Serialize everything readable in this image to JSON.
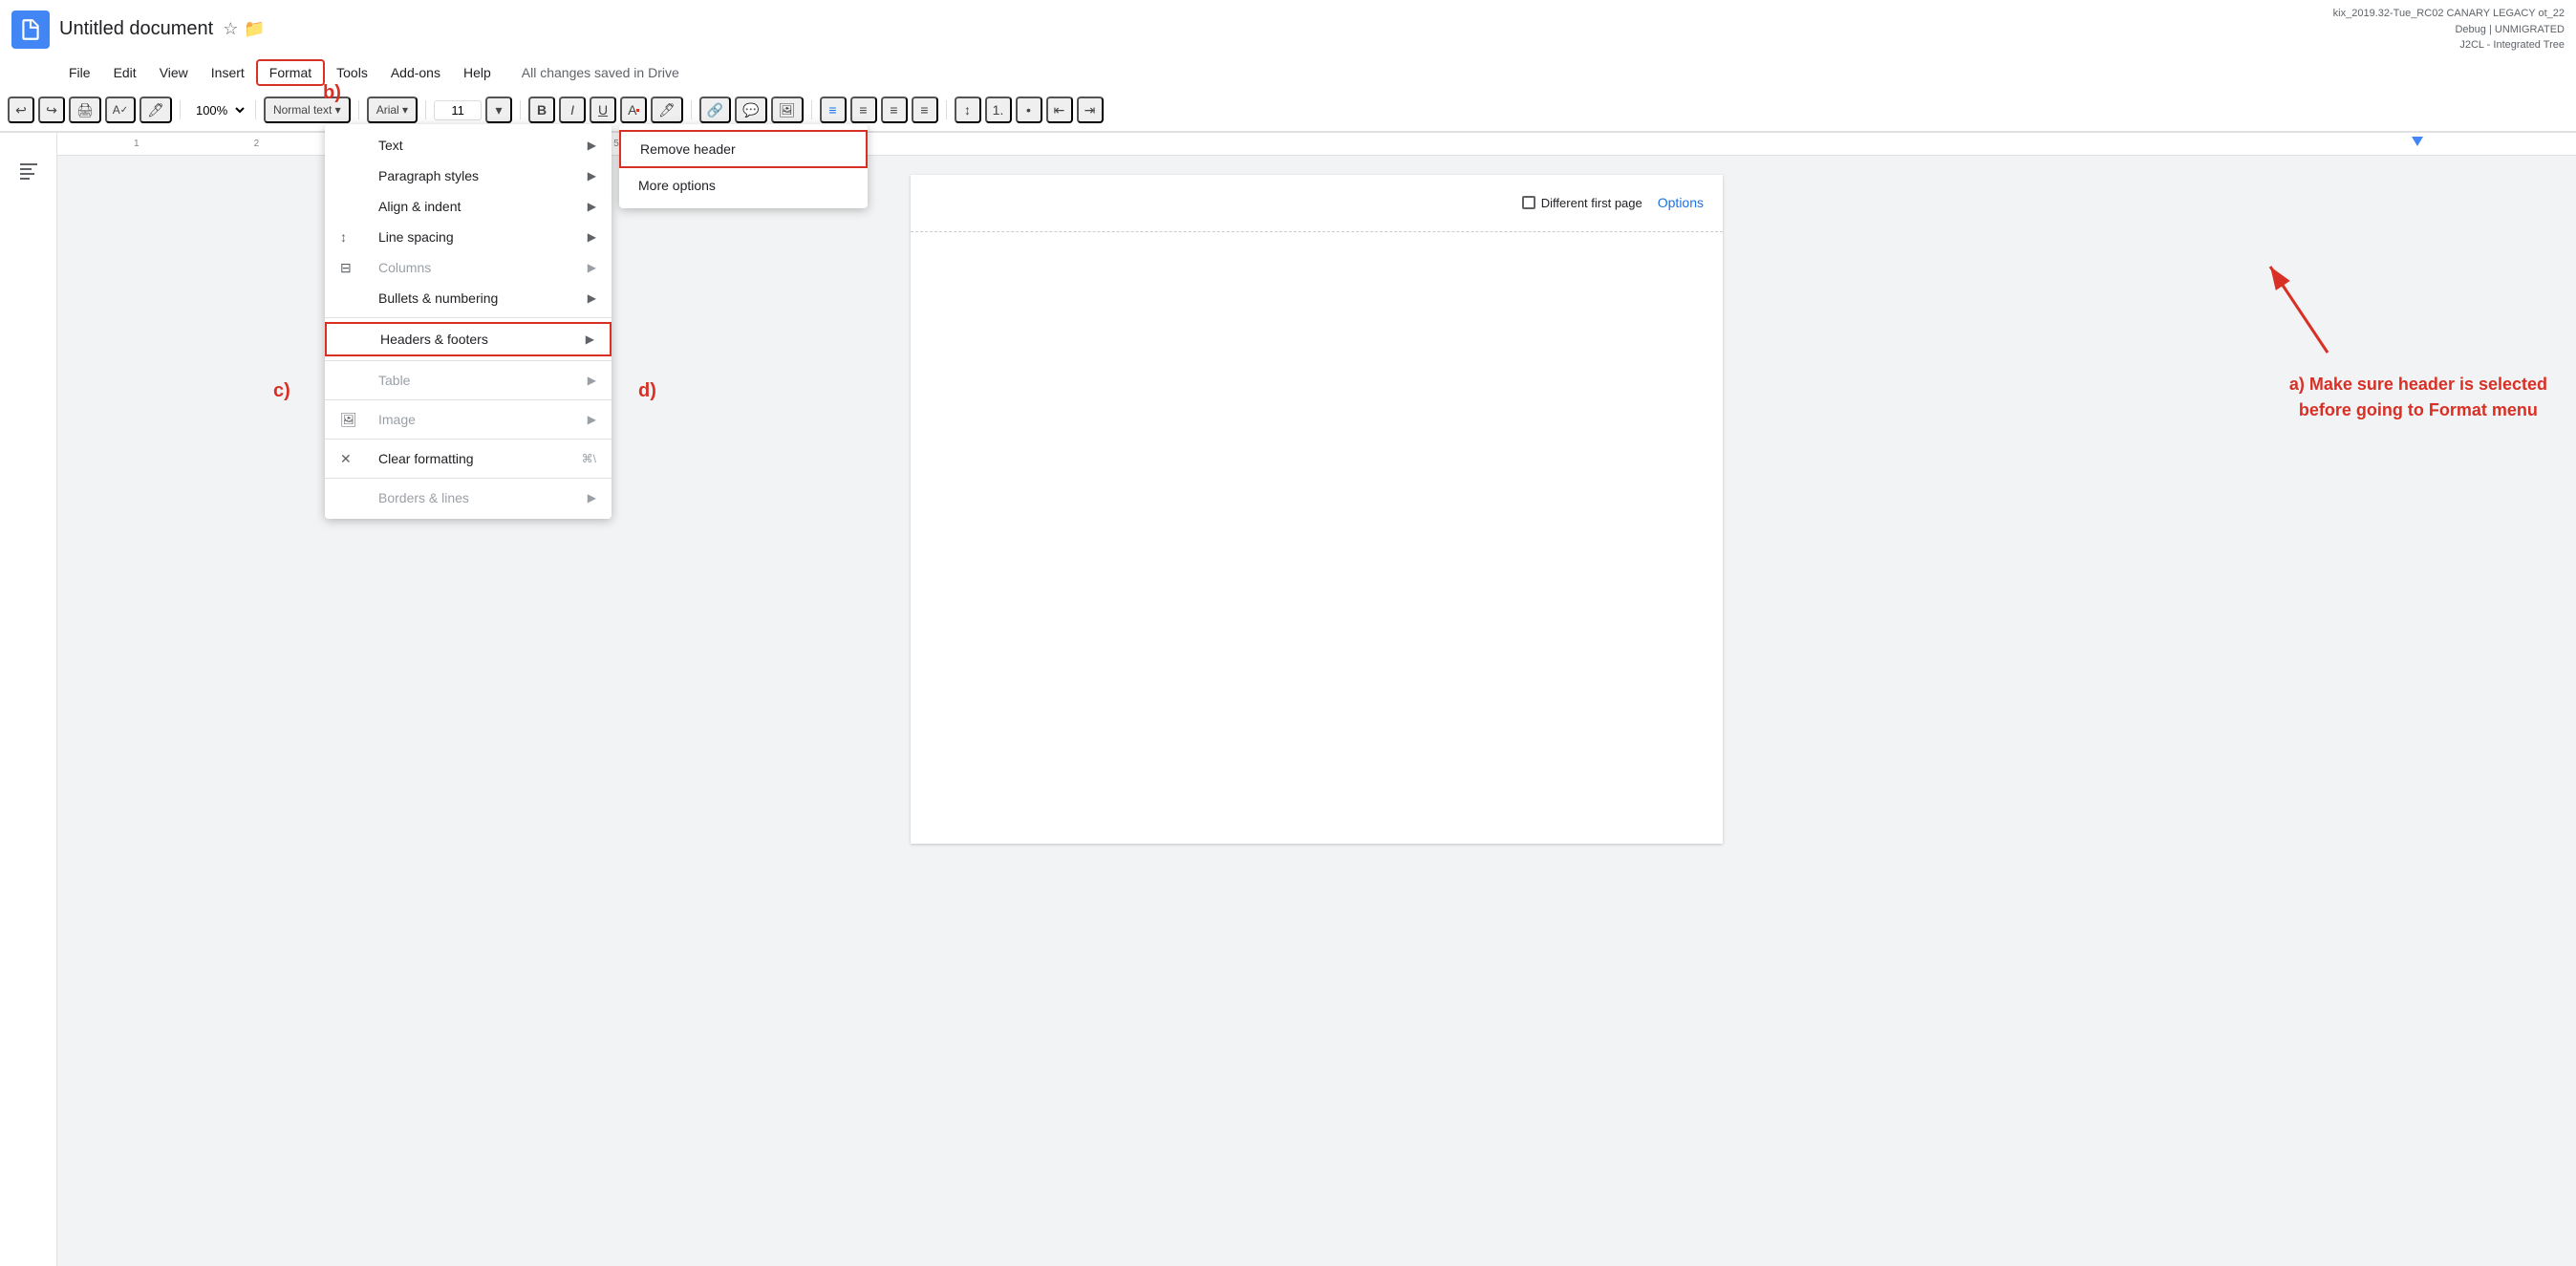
{
  "app": {
    "title": "Untitled document",
    "version_info": "kix_2019.32-Tue_RC02 CANARY LEGACY ot_22\nDebug | UNMIGRATED\nJ2CL - Integrated Tree",
    "save_status": "All changes saved in Drive"
  },
  "menu_bar": {
    "items": [
      "File",
      "Edit",
      "View",
      "Insert",
      "Format",
      "Tools",
      "Add-ons",
      "Help"
    ]
  },
  "toolbar": {
    "zoom": "100%",
    "font_size": "11"
  },
  "format_menu": {
    "items": [
      {
        "label": "Text",
        "has_submenu": true,
        "disabled": false
      },
      {
        "label": "Paragraph styles",
        "has_submenu": true,
        "disabled": false
      },
      {
        "label": "Align & indent",
        "has_submenu": true,
        "disabled": false
      },
      {
        "label": "Line spacing",
        "has_submenu": true,
        "icon": "≡",
        "disabled": false
      },
      {
        "label": "Columns",
        "has_submenu": true,
        "icon": "⊞",
        "disabled": true
      },
      {
        "label": "Bullets & numbering",
        "has_submenu": true,
        "disabled": false
      },
      {
        "label": "Headers & footers",
        "has_submenu": true,
        "disabled": false,
        "highlighted": true
      },
      {
        "label": "Table",
        "has_submenu": true,
        "disabled": true
      },
      {
        "label": "Image",
        "has_submenu": true,
        "icon": "🖼",
        "disabled": true
      },
      {
        "label": "Clear formatting",
        "shortcut": "⌘\\",
        "disabled": false
      },
      {
        "label": "Borders & lines",
        "has_submenu": true,
        "disabled": true
      }
    ]
  },
  "hf_submenu": {
    "items": [
      {
        "label": "Remove header",
        "highlighted": true
      },
      {
        "label": "More options",
        "highlighted": false
      }
    ]
  },
  "header_area": {
    "different_first_page": "Different first page",
    "options_link": "Options"
  },
  "annotations": {
    "label_a": "a) Make sure header is selected\nbefore going to Format menu",
    "label_b": "b)",
    "label_c": "c)",
    "label_d": "d)"
  }
}
